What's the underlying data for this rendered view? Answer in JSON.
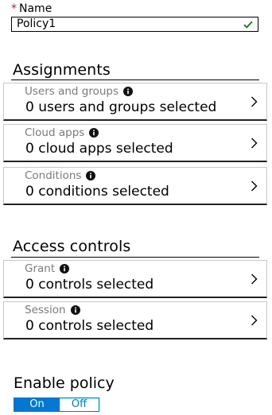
{
  "name_field": {
    "required_marker": "*",
    "label": "Name",
    "value": "Policy1"
  },
  "assignments": {
    "title": "Assignments",
    "items": [
      {
        "title": "Users and groups",
        "value": "0 users and groups selected"
      },
      {
        "title": "Cloud apps",
        "value": "0 cloud apps selected"
      },
      {
        "title": "Conditions",
        "value": "0 conditions selected"
      }
    ]
  },
  "access_controls": {
    "title": "Access controls",
    "items": [
      {
        "title": "Grant",
        "value": "0 controls selected"
      },
      {
        "title": "Session",
        "value": "0 controls selected"
      }
    ]
  },
  "enable_policy": {
    "label": "Enable policy",
    "on_label": "On",
    "off_label": "Off",
    "selected": "On"
  },
  "colors": {
    "accent": "#0078d4",
    "required": "#e81123",
    "valid_check": "#107c10",
    "muted_text": "#7a7a7a"
  },
  "icons": [
    "checkmark-icon",
    "info-icon",
    "chevron-right-icon"
  ]
}
